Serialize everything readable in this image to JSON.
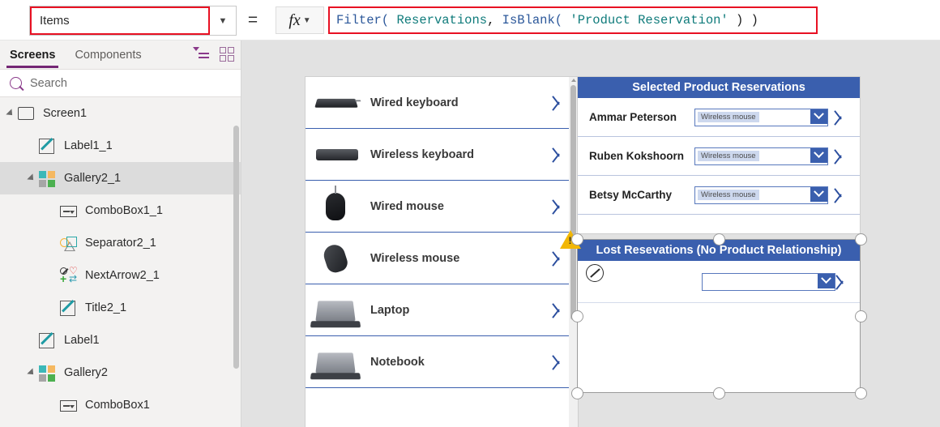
{
  "formula_bar": {
    "property_value": "Items",
    "equals": "=",
    "fx_label": "fx",
    "formula_tokens": [
      {
        "t": "Filter(",
        "cls": "tk-fn"
      },
      {
        "t": " ",
        "cls": "tk-pn"
      },
      {
        "t": "Reservations",
        "cls": "tk-tbl"
      },
      {
        "t": ", ",
        "cls": "tk-pn"
      },
      {
        "t": "IsBlank(",
        "cls": "tk-fn"
      },
      {
        "t": " ",
        "cls": "tk-pn"
      },
      {
        "t": "'Product Reservation'",
        "cls": "tk-str"
      },
      {
        "t": " ) )",
        "cls": "tk-pn"
      }
    ],
    "formula_text": "Filter( Reservations, IsBlank( 'Product Reservation' ) )"
  },
  "left_panel": {
    "tabs": [
      {
        "label": "Screens",
        "active": true
      },
      {
        "label": "Components",
        "active": false
      }
    ],
    "view_icons": [
      "tree-view-icon",
      "thumbnail-view-icon"
    ],
    "search_placeholder": "Search",
    "tree_items": [
      {
        "label": "Screen1",
        "icon": "screen-icon",
        "indent": 0,
        "twisty": true,
        "selected": false
      },
      {
        "label": "Label1_1",
        "icon": "label-icon",
        "indent": 1,
        "twisty": false,
        "selected": false
      },
      {
        "label": "Gallery2_1",
        "icon": "gallery-icon",
        "indent": 1,
        "twisty": true,
        "selected": true
      },
      {
        "label": "ComboBox1_1",
        "icon": "combobox-icon",
        "indent": 2,
        "twisty": false,
        "selected": false
      },
      {
        "label": "Separator2_1",
        "icon": "separator-icon",
        "indent": 2,
        "twisty": false,
        "selected": false
      },
      {
        "label": "NextArrow2_1",
        "icon": "nextarrow-icon",
        "indent": 2,
        "twisty": false,
        "selected": false
      },
      {
        "label": "Title2_1",
        "icon": "label-icon",
        "indent": 2,
        "twisty": false,
        "selected": false
      },
      {
        "label": "Label1",
        "icon": "label-icon",
        "indent": 1,
        "twisty": false,
        "selected": false
      },
      {
        "label": "Gallery2",
        "icon": "gallery-icon",
        "indent": 1,
        "twisty": true,
        "selected": false
      },
      {
        "label": "ComboBox1",
        "icon": "combobox-icon",
        "indent": 2,
        "twisty": false,
        "selected": false
      }
    ]
  },
  "canvas": {
    "product_gallery": {
      "rows": [
        {
          "name": "Notebook",
          "thumb": "notebook-image"
        },
        {
          "name": "Laptop",
          "thumb": "laptop-image"
        },
        {
          "name": "Wireless mouse",
          "thumb": "wireless-mouse-image"
        },
        {
          "name": "Wired mouse",
          "thumb": "wired-mouse-image"
        },
        {
          "name": "Wireless keyboard",
          "thumb": "wireless-keyboard-image"
        },
        {
          "name": "Wired keyboard",
          "thumb": "wired-keyboard-image"
        }
      ]
    },
    "selected_reservations": {
      "title": "Selected Product Reservations",
      "rows": [
        {
          "person": "Ammar Peterson",
          "product": "Wireless mouse"
        },
        {
          "person": "Ruben Kokshoorn",
          "product": "Wireless mouse"
        },
        {
          "person": "Betsy McCarthy",
          "product": "Wireless mouse"
        }
      ]
    },
    "lost_reservations": {
      "title": "Lost Resevations (No Product Relationship)",
      "rows": [
        {
          "person": "",
          "product": ""
        }
      ],
      "warning_icon": "warning-triangle-icon",
      "edit_badge_icon": "edit-pencil-icon"
    }
  },
  "colors": {
    "panel_header_blue": "#3a5fae",
    "accent_purple": "#742774",
    "highlight_red": "#e81123",
    "warning_yellow": "#f2b705",
    "canvas_bg": "#e2e2e2"
  }
}
